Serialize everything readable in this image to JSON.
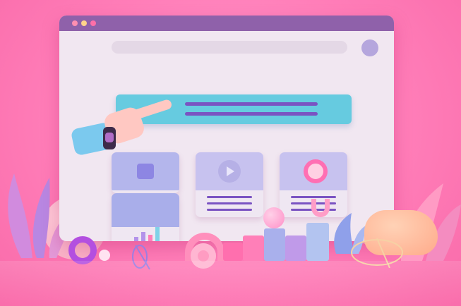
{
  "scene": {
    "colors": {
      "background": "#ff80bb",
      "window_body": "#f1e7f1",
      "title_bar": "#8f61aa",
      "banner": "#66cbe0",
      "banner_lines": "#7a53c2",
      "card_header": "#b4b6ec",
      "avatar": "#b5a6dd"
    },
    "window_controls": [
      "red-dot",
      "amber-dot",
      "teal-dot"
    ],
    "cards": [
      {
        "name": "image-card",
        "icon": "square-icon"
      },
      {
        "name": "video-card",
        "icon": "play-icon"
      },
      {
        "name": "profile-card",
        "icon": "ring-icon"
      }
    ],
    "chart_card_bars": [
      0.5,
      0.75,
      0.6,
      1.0
    ],
    "decor": [
      "pink-sphere",
      "magenta-ring",
      "blocks",
      "leaves",
      "peach-sphere",
      "coral-blob",
      "gold-ring"
    ]
  }
}
